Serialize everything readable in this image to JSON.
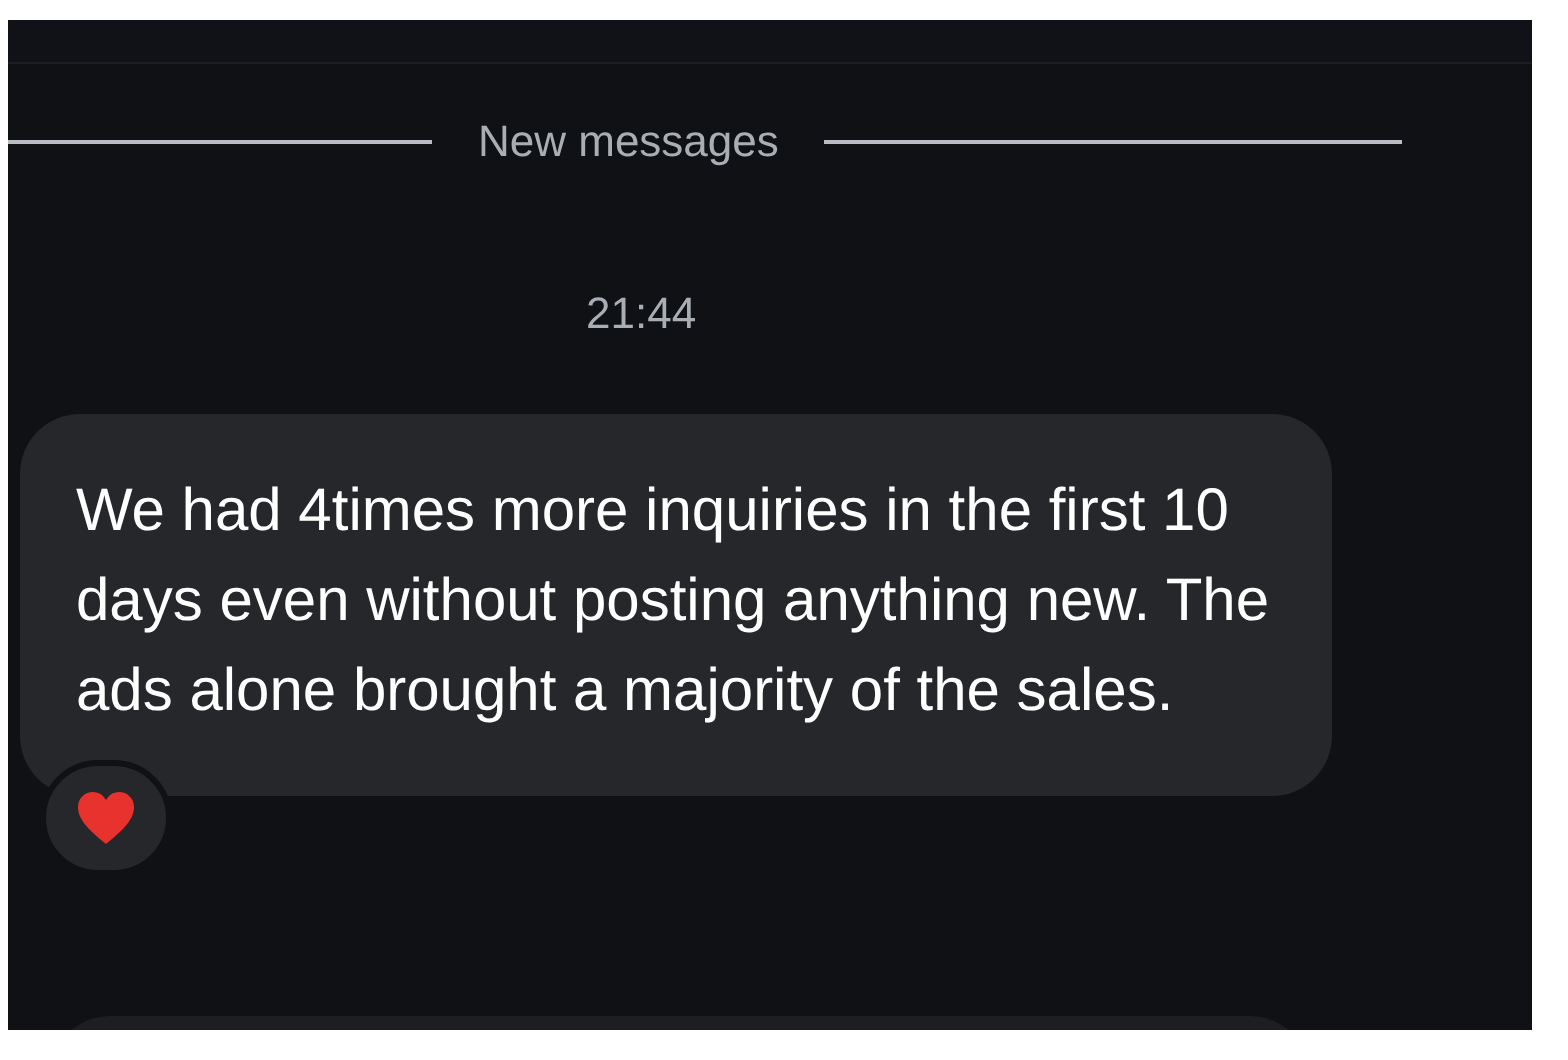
{
  "divider": {
    "label": "New messages"
  },
  "timestamp": "21:44",
  "messages": [
    {
      "text": "We had 4times more inquiries in the first 10 days even without posting anything new. The ads alone brought a majority of the sales.",
      "reacted": true
    }
  ]
}
